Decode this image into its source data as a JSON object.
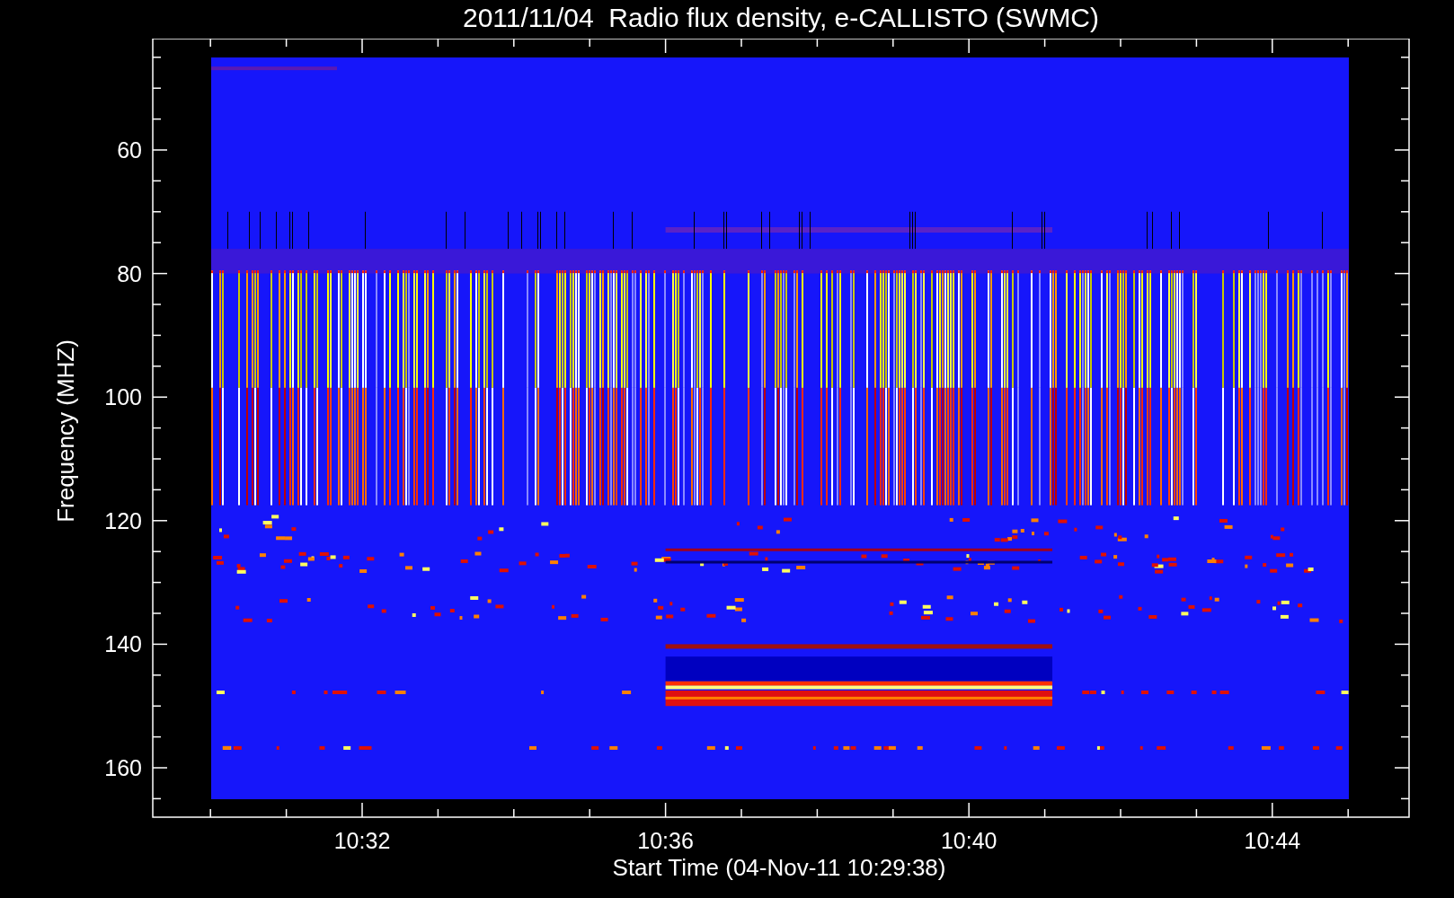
{
  "plot": {
    "title": "2011/11/04  Radio flux density, e-CALLISTO (SWMC)",
    "ylabel": "Frequency (MHZ)",
    "xlabel": "Start Time (04-Nov-11 10:29:38)",
    "yticks": [
      "60",
      "80",
      "100",
      "120",
      "140",
      "160"
    ],
    "xticks": [
      "10:32",
      "10:36",
      "10:40",
      "10:44"
    ]
  }
}
